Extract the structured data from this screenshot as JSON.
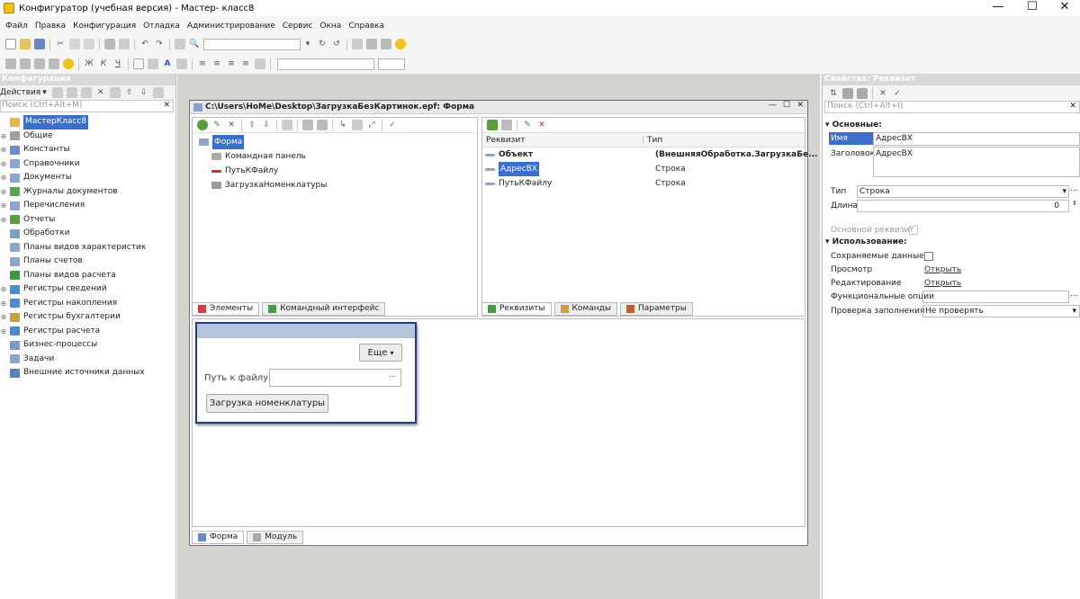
{
  "window": {
    "title": "Конфигуратор (учебная версия) - Мастер- класс8"
  },
  "menu": [
    "Файл",
    "Правка",
    "Конфигурация",
    "Отладка",
    "Администрирование",
    "Сервис",
    "Окна",
    "Справка"
  ],
  "left": {
    "title": "Конфигурация",
    "actions": "Действия",
    "search_placeholder": "Поиск (Ctrl+Alt+M)",
    "items": [
      "МастерКласс8",
      "Общие",
      "Константы",
      "Справочники",
      "Документы",
      "Журналы документов",
      "Перечисления",
      "Отчеты",
      "Обработки",
      "Планы видов характеристик",
      "Планы счетов",
      "Планы видов расчета",
      "Регистры сведений",
      "Регистры накопления",
      "Регистры бухгалтерии",
      "Регистры расчета",
      "Бизнес-процессы",
      "Задачи",
      "Внешние источники данных"
    ]
  },
  "form": {
    "title": "C:\\Users\\HoMe\\Desktop\\ЗагрузкаБезКартинок.epf: Форма",
    "elements": [
      "Форма",
      "Командная панель",
      "ПутьКФайлу",
      "ЗагрузкаНоменклатуры"
    ],
    "col_requisite": "Реквизит",
    "col_type": "Тип",
    "requisites": [
      {
        "name": "Объект",
        "type": "(ВнешняяОбработка.ЗагрузкаБе..."
      },
      {
        "name": "АдресВХ",
        "type": "Строка"
      },
      {
        "name": "ПутьКФайлу",
        "type": "Строка"
      }
    ],
    "tabs_left": [
      "Элементы",
      "Командный интерфейс"
    ],
    "tabs_right": [
      "Реквизиты",
      "Команды",
      "Параметры"
    ],
    "preview": {
      "more": "Еще",
      "path_label": "Путь к файлу:",
      "path_btn": "...",
      "load": "Загрузка номенклатуры"
    },
    "bottom_tabs": [
      "Форма",
      "Модуль"
    ]
  },
  "props": {
    "title": "Свойства: Реквизит",
    "search_placeholder": "Поиск (Ctrl+Alt+I)",
    "section_main": "Основные:",
    "name_label": "Имя",
    "name_value": "АдресВХ",
    "caption_label": "Заголовок",
    "caption_value": "АдресВХ",
    "type_label": "Тип",
    "type_value": "Строка",
    "length_label": "Длина",
    "length_value": "0",
    "main_req": "Основной реквизит",
    "section_use": "Использование:",
    "saved": "Сохраняемые данные",
    "view": "Просмотр",
    "view_link": "Открыть",
    "edit": "Редактирование",
    "edit_link": "Открыть",
    "func": "Функциональные опции",
    "check": "Проверка заполнения",
    "check_value": "Не проверять",
    "dots": "..."
  }
}
